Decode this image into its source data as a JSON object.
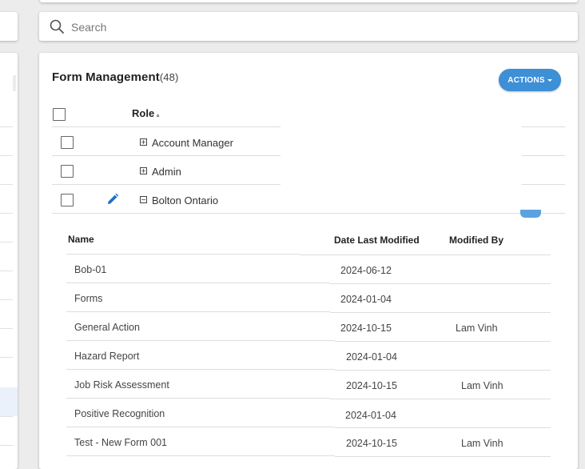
{
  "search": {
    "placeholder": "Search"
  },
  "form_management": {
    "title": "Form Management",
    "count": "(48)",
    "actions_label": "ACTIONS"
  },
  "roles": {
    "header": "Role",
    "items": [
      {
        "label": "Account Manager",
        "expanded": false
      },
      {
        "label": "Admin",
        "expanded": false
      },
      {
        "label": "Bolton Ontario",
        "expanded": true
      }
    ]
  },
  "forms_table": {
    "columns": [
      "Name",
      "Date Last Modified",
      "Modified By"
    ],
    "rows": [
      {
        "name": "Bob-01",
        "date": "2024-06-12",
        "modified_by": ""
      },
      {
        "name": "Forms",
        "date": "2024-01-04",
        "modified_by": ""
      },
      {
        "name": "General Action",
        "date": "2024-10-15",
        "modified_by": "Lam Vinh"
      },
      {
        "name": "Hazard Report",
        "date": "2024-01-04",
        "modified_by": ""
      },
      {
        "name": "Job Risk Assessment",
        "date": "2024-10-15",
        "modified_by": "Lam Vinh"
      },
      {
        "name": "Positive Recognition",
        "date": "2024-01-04",
        "modified_by": ""
      },
      {
        "name": "Test - New Form 001",
        "date": "2024-10-15",
        "modified_by": "Lam Vinh"
      }
    ]
  },
  "colors": {
    "accent": "#3d8fd6",
    "edit_icon": "#1f6fc4"
  }
}
